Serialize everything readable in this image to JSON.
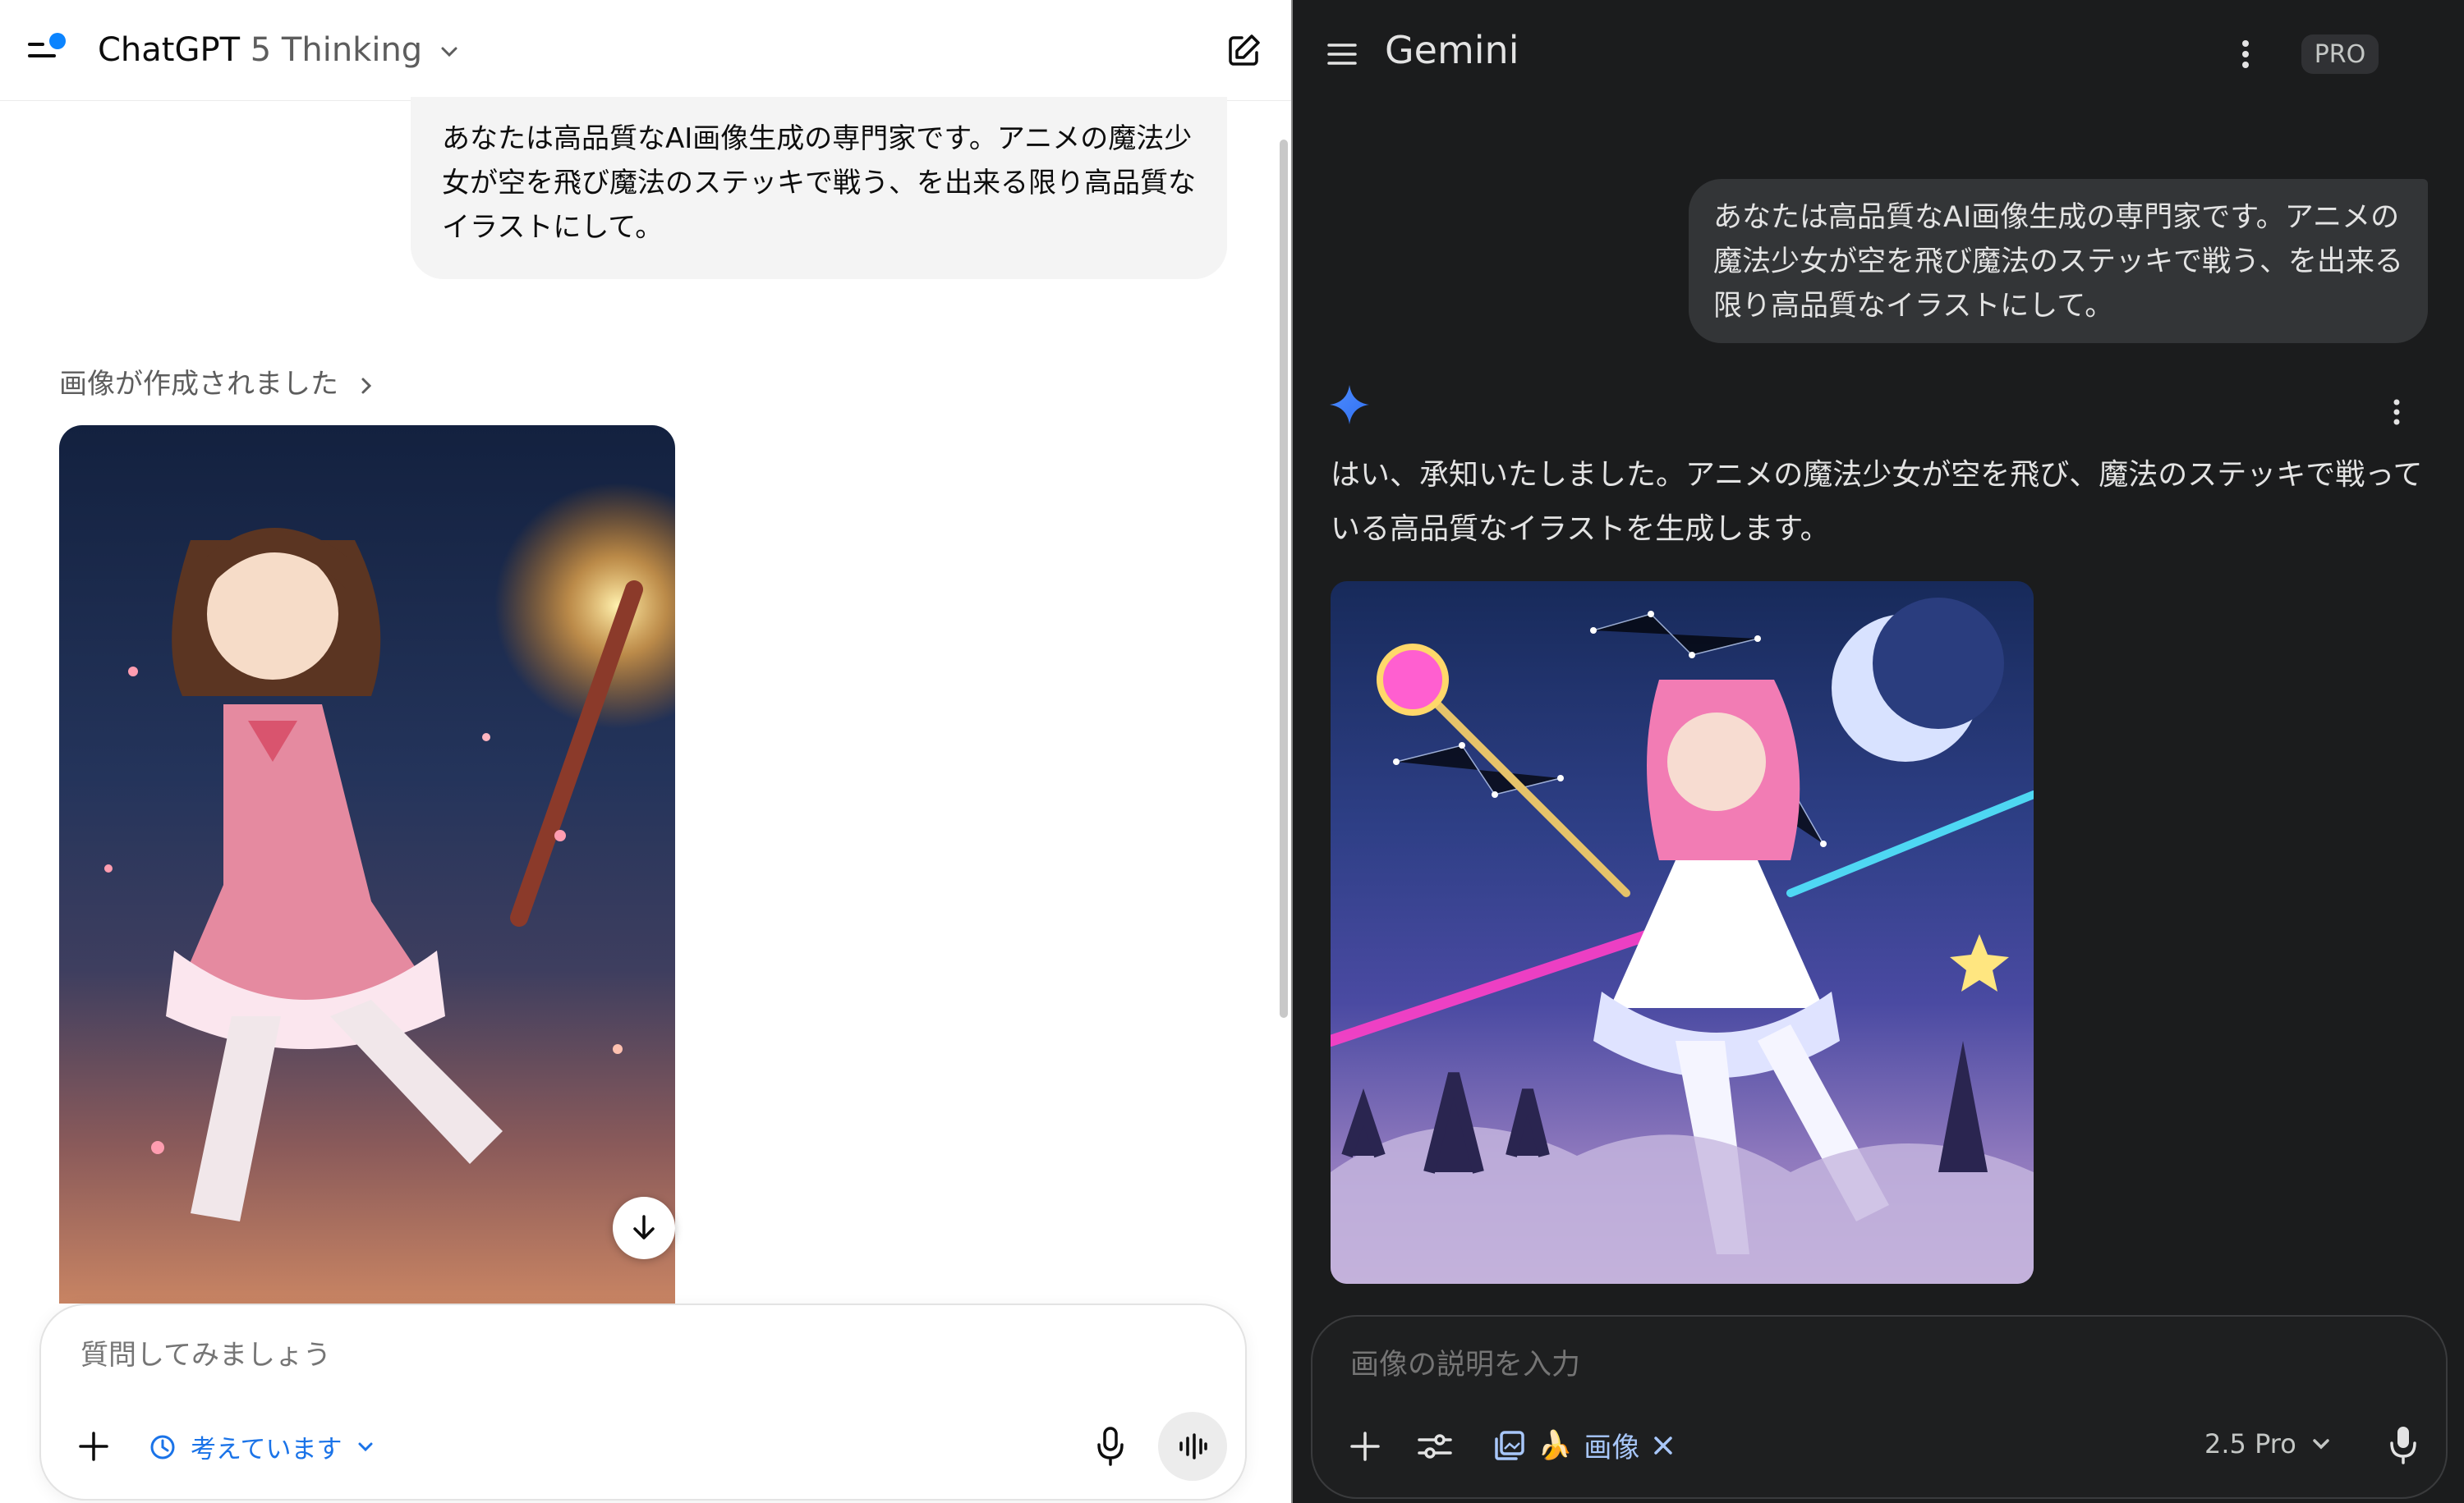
{
  "chatgpt": {
    "title_main": "ChatGPT",
    "title_sub": "5 Thinking",
    "user_message": "あなたは高品質なAI画像生成の専門家です。アニメの魔法少女が空を飛び魔法のステッキで戦う、を出来る限り高品質なイラストにして。",
    "created_label": "画像が作成されました",
    "input_placeholder": "質問してみましょう",
    "thinking_label": "考えています",
    "icons": [
      "sidebar-toggle-icon",
      "chevron-down-icon",
      "new-chat-icon",
      "chevron-right-icon",
      "download-arrow-icon",
      "plus-icon",
      "thinking-clock-icon",
      "mic-icon",
      "voice-waveform-icon"
    ],
    "accent_color": "#1a73e8"
  },
  "gemini": {
    "title": "Gemini",
    "badge": "PRO",
    "user_message": "あなたは高品質なAI画像生成の専門家です。アニメの魔法少女が空を飛び魔法のステッキで戦う、を出来る限り高品質なイラストにして。",
    "reply": "はい、承知いたしました。アニメの魔法少女が空を飛び、魔法のステッキで戦っている高品質なイラストを生成します。",
    "input_placeholder": "画像の説明を入力",
    "image_chip_label": "画像",
    "image_chip_emoji": "🍌",
    "model_label": "2.5 Pro",
    "icons": [
      "hamburger-menu-icon",
      "more-vert-icon",
      "gemini-sparkle-icon",
      "plus-icon",
      "tools-icon",
      "image-gallery-icon",
      "close-icon",
      "chevron-down-icon",
      "mic-icon"
    ],
    "accent_color": "#a8c7fa"
  }
}
